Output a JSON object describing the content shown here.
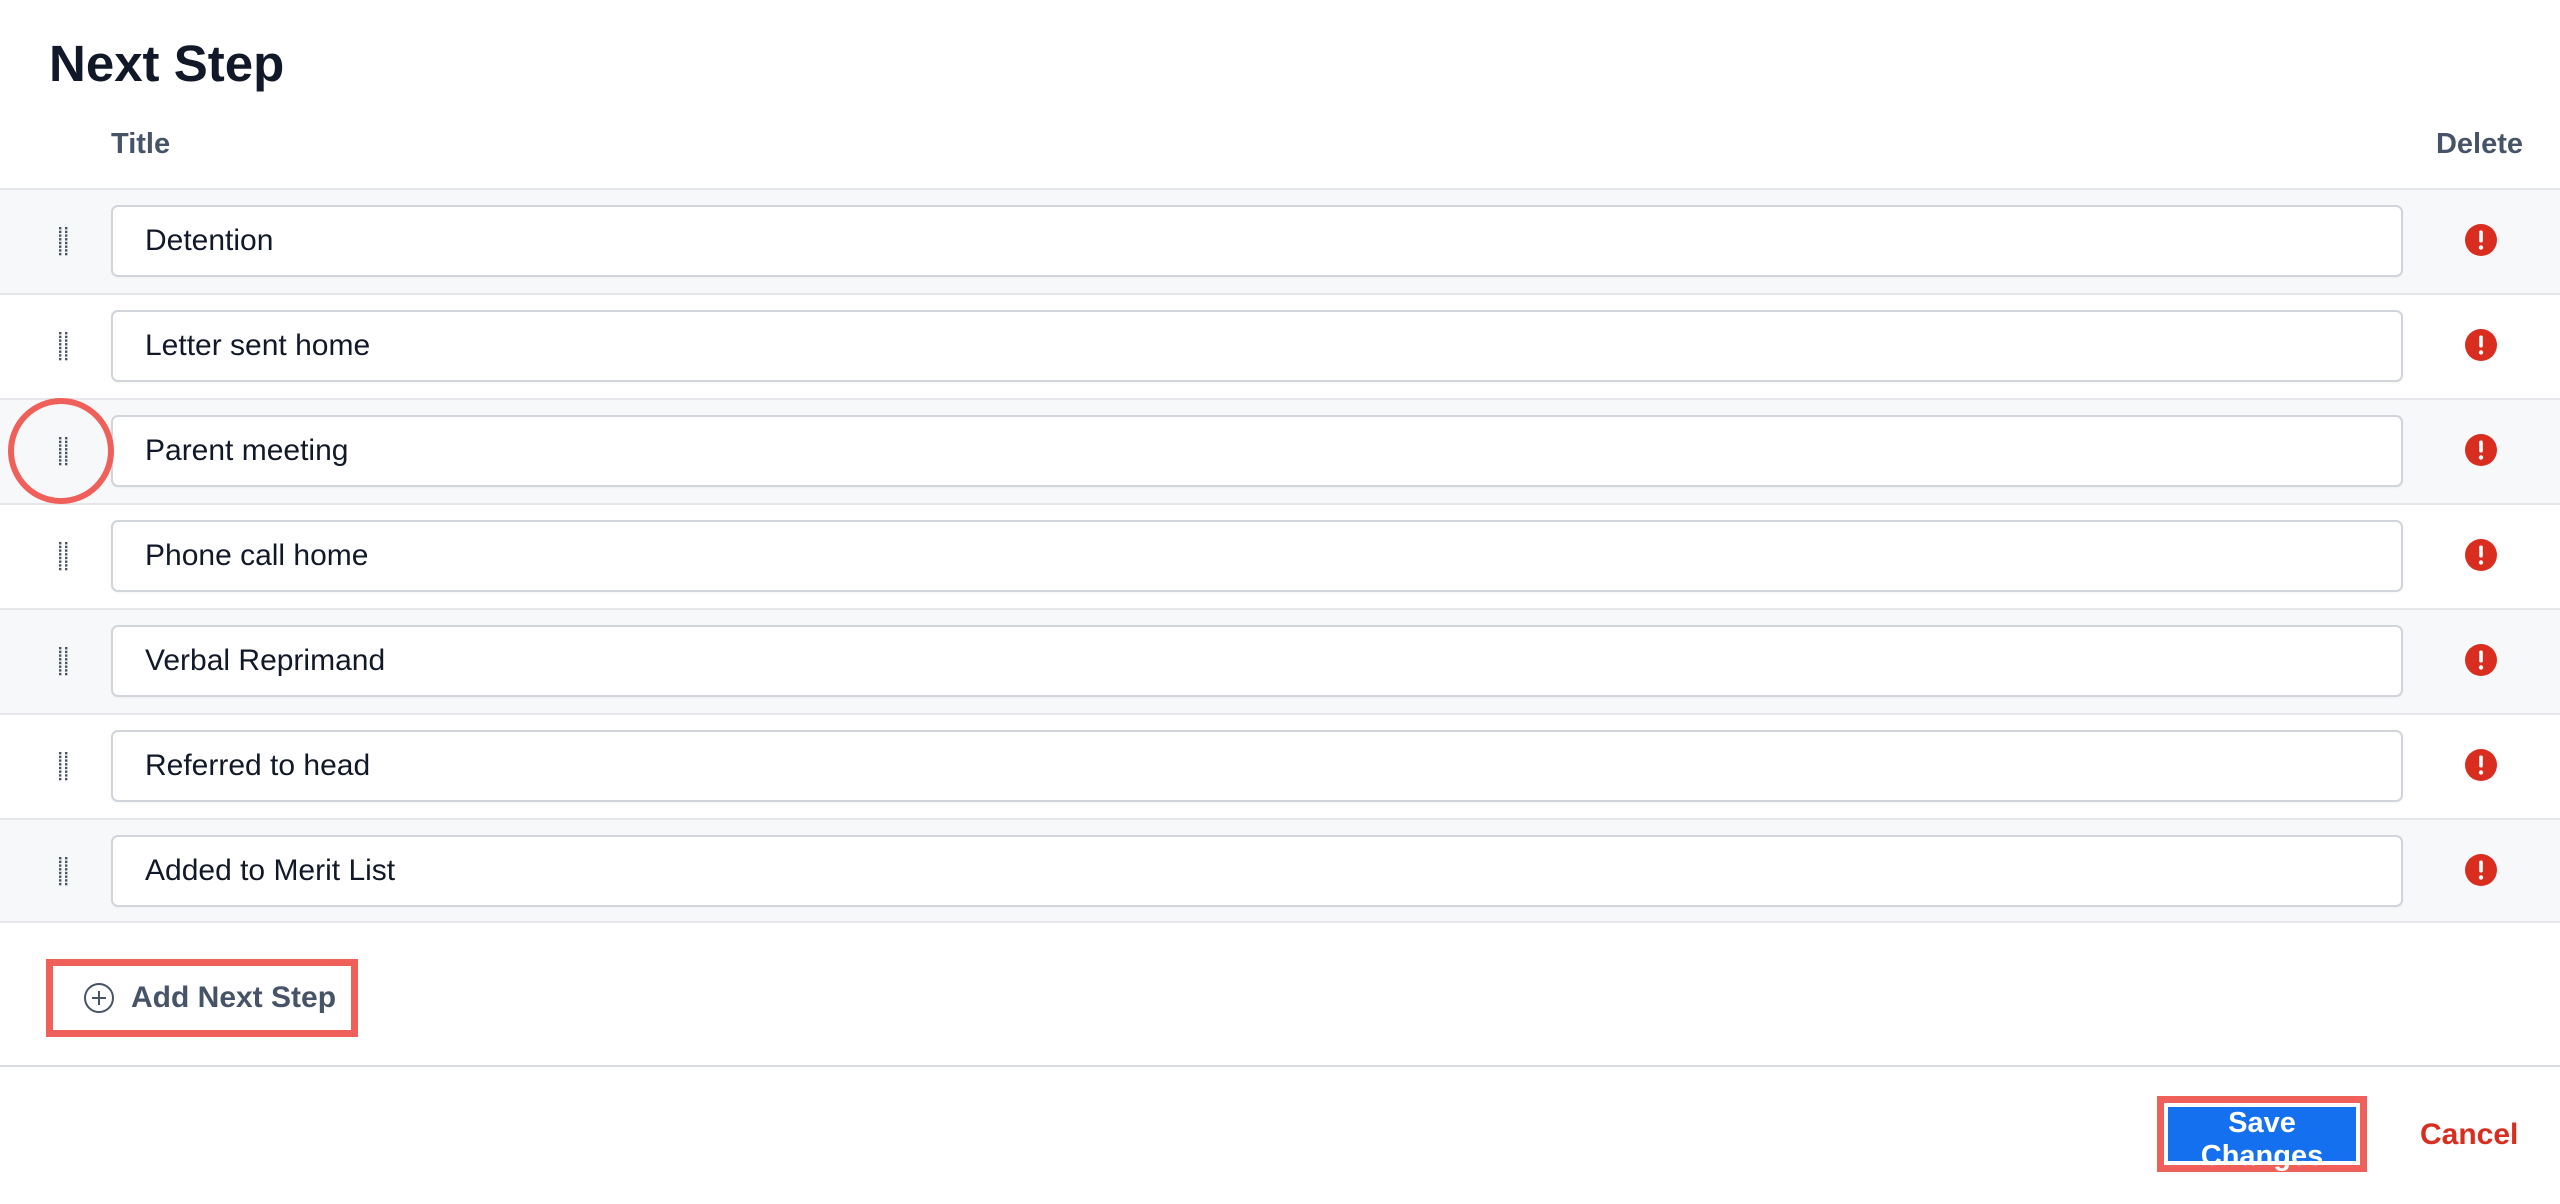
{
  "page": {
    "title": "Next Step"
  },
  "table": {
    "columns": {
      "title": "Title",
      "delete": "Delete"
    },
    "rows": [
      {
        "value": "Detention"
      },
      {
        "value": "Letter sent home"
      },
      {
        "value": "Parent meeting"
      },
      {
        "value": "Phone call home"
      },
      {
        "value": "Verbal Reprimand"
      },
      {
        "value": "Referred to head"
      },
      {
        "value": "Added to Merit List"
      }
    ]
  },
  "actions": {
    "add_label": "Add Next Step",
    "save_label": "Save Changes",
    "cancel_label": "Cancel"
  },
  "icons": {
    "drag": "drag-handle-icon",
    "delete": "exclamation-circle-icon",
    "add": "plus-circle-icon"
  },
  "colors": {
    "primary": "#1570ef",
    "danger": "#d92d20",
    "highlight": "#f0605a",
    "row_alt": "#f7f8fa"
  }
}
